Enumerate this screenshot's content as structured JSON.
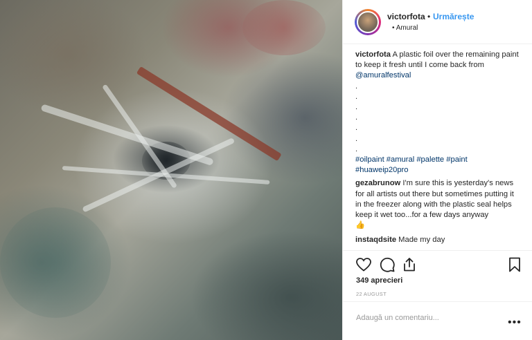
{
  "post": {
    "username": "victorfota",
    "separator": "•",
    "follow_label": "Urmărește",
    "location": "• Amural"
  },
  "caption": {
    "author": "victorfota",
    "text": "A plastic foil over the remaining paint to keep it fresh until I come back from",
    "mention": "@amuralfestival",
    "dots": [
      ".",
      ".",
      ".",
      ".",
      ".",
      ".",
      "."
    ],
    "hashtags": [
      "#oilpaint",
      "#amural",
      "#palette",
      "#paint",
      "#huaweip20pro"
    ]
  },
  "comments": [
    {
      "author": "gezabrunow",
      "text": "I'm sure this is yesterday's news for all artists out there but sometimes putting it in the freezer along with the plastic seal helps keep it wet too...for a few days anyway",
      "emoji": "👍"
    },
    {
      "author": "instaqdsite",
      "text": "Made my day"
    }
  ],
  "actions": {
    "icons": [
      "heart-icon",
      "comment-icon",
      "share-icon",
      "bookmark-icon"
    ]
  },
  "likes": "349 aprecieri",
  "date": "22 AUGUST",
  "add_comment": {
    "placeholder": "Adaugă un comentariu...",
    "more_label": "•••"
  },
  "colors": {
    "link": "#003569",
    "follow": "#3897f0",
    "text": "#262626",
    "muted": "#999999"
  }
}
